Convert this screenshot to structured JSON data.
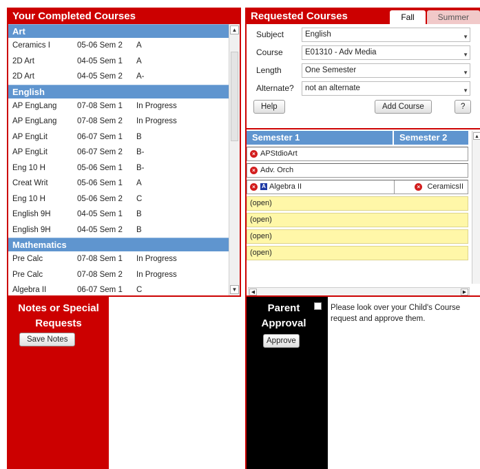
{
  "completed": {
    "title": "Your Completed Courses",
    "categories": [
      {
        "name": "Art",
        "rows": [
          {
            "course": "Ceramics I",
            "term": "05-06 Sem 2",
            "grade": "A"
          },
          {
            "course": "2D Art",
            "term": "04-05 Sem 1",
            "grade": "A"
          },
          {
            "course": "2D Art",
            "term": "04-05 Sem 2",
            "grade": "A-"
          }
        ]
      },
      {
        "name": "English",
        "rows": [
          {
            "course": "AP EngLang",
            "term": "07-08 Sem 1",
            "grade": "In Progress"
          },
          {
            "course": "AP EngLang",
            "term": "07-08 Sem 2",
            "grade": "In Progress"
          },
          {
            "course": "AP EngLit",
            "term": "06-07 Sem 1",
            "grade": "B"
          },
          {
            "course": "AP EngLit",
            "term": "06-07 Sem 2",
            "grade": "B-"
          },
          {
            "course": "Eng 10 H",
            "term": "05-06 Sem 1",
            "grade": "B-"
          },
          {
            "course": "Creat Writ",
            "term": "05-06 Sem 1",
            "grade": "A"
          },
          {
            "course": "Eng 10 H",
            "term": "05-06 Sem 2",
            "grade": "C"
          },
          {
            "course": "English 9H",
            "term": "04-05 Sem 1",
            "grade": "B"
          },
          {
            "course": "English 9H",
            "term": "04-05 Sem 2",
            "grade": "B"
          }
        ]
      },
      {
        "name": "Mathematics",
        "rows": [
          {
            "course": "Pre Calc",
            "term": "07-08 Sem 1",
            "grade": "In Progress"
          },
          {
            "course": "Pre Calc",
            "term": "07-08 Sem 2",
            "grade": "In Progress"
          },
          {
            "course": "Algebra II",
            "term": "06-07 Sem 1",
            "grade": "C"
          }
        ]
      }
    ]
  },
  "requested": {
    "title": "Requested Courses",
    "tabs": {
      "fall": "Fall",
      "summer": "Summer"
    },
    "form": {
      "subject_label": "Subject",
      "subject_value": "English",
      "course_label": "Course",
      "course_value": "E01310 - Adv Media",
      "length_label": "Length",
      "length_value": "One Semester",
      "alternate_label": "Alternate?",
      "alternate_value": "not an alternate"
    },
    "buttons": {
      "help": "Help",
      "add_course": "Add Course",
      "question": "?"
    },
    "grid": {
      "sem1_header": "Semester 1",
      "sem2_header": "Semester 2",
      "slot1": "APStdioArt",
      "slot2": "Adv. Orch",
      "slot3_sem1": "Algebra II",
      "slot3_sem2": "CeramicsII",
      "alt_badge": "A",
      "open_label": "(open)"
    }
  },
  "notes": {
    "title": "Notes or Special Requests",
    "save_label": "Save Notes"
  },
  "approval": {
    "title": "Parent Approval",
    "approve_label": "Approve",
    "message": "Please look over your Child's Course request and approve them."
  },
  "colors": {
    "accent": "#cc0000",
    "header_blue": "#5f95cf",
    "open_slot": "#fff7a8"
  }
}
